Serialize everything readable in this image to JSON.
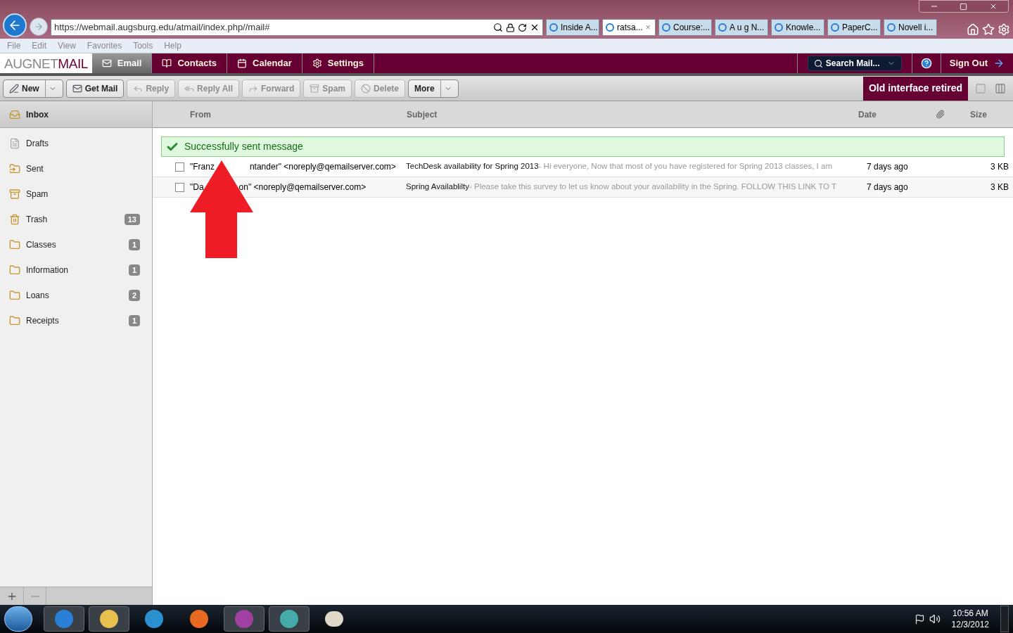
{
  "browser": {
    "address": "https://webmail.augsburg.edu/atmail/index.php//mail#",
    "tabs": [
      {
        "label": "Inside A...",
        "selected": false
      },
      {
        "label": "ratsa...",
        "selected": true,
        "close": "×"
      },
      {
        "label": "Course:...",
        "selected": false
      },
      {
        "label": "A u g N...",
        "selected": false
      },
      {
        "label": "Knowle...",
        "selected": false
      },
      {
        "label": "PaperC...",
        "selected": false
      },
      {
        "label": "Novell i...",
        "selected": false
      }
    ],
    "menu": [
      "File",
      "Edit",
      "View",
      "Favorites",
      "Tools",
      "Help"
    ]
  },
  "app": {
    "logo_light": "AUGNET",
    "logo_dark": "MAIL",
    "nav": [
      {
        "label": "Email",
        "selected": true
      },
      {
        "label": "Contacts",
        "selected": false
      },
      {
        "label": "Calendar",
        "selected": false
      },
      {
        "label": "Settings",
        "selected": false
      }
    ],
    "search": {
      "placeholder": "Search Mail..."
    },
    "sign_out": "Sign Out",
    "toolbar": [
      {
        "label": "New",
        "disabled": false,
        "dropdown": true
      },
      {
        "label": "Get Mail",
        "disabled": false,
        "dropdown": false
      },
      {
        "label": "Reply",
        "disabled": true,
        "dropdown": false
      },
      {
        "label": "Reply All",
        "disabled": true,
        "dropdown": false
      },
      {
        "label": "Forward",
        "disabled": true,
        "dropdown": false
      },
      {
        "label": "Spam",
        "disabled": true,
        "dropdown": false
      },
      {
        "label": "Delete",
        "disabled": true,
        "dropdown": false
      },
      {
        "label": "More",
        "disabled": false,
        "dropdown": true
      }
    ],
    "notice": "Old interface retired",
    "folders": [
      {
        "name": "Inbox",
        "selected": true
      },
      {
        "name": "Drafts",
        "selected": false
      },
      {
        "name": "Sent",
        "selected": false
      },
      {
        "name": "Spam",
        "selected": false
      },
      {
        "name": "Trash",
        "selected": false,
        "count": "13"
      },
      {
        "name": "Classes",
        "selected": false,
        "count": "1"
      },
      {
        "name": "Information",
        "selected": false,
        "count": "1"
      },
      {
        "name": "Loans",
        "selected": false,
        "count": "2"
      },
      {
        "name": "Receipts",
        "selected": false,
        "count": "1"
      }
    ],
    "columns": {
      "from": "From",
      "subject": "Subject",
      "date": "Date",
      "size": "Size"
    },
    "success": "Successfully sent message",
    "messages": [
      {
        "checked": false,
        "from_start": "\"Franz",
        "from_end": "ntander\" <noreply@qemailserver.com>",
        "subject": "TechDesk availability for Spring 2013",
        "preview": " - Hi everyone, Now that most of you have registered for Spring 2013 classes, I am",
        "date": "7 days ago",
        "size": "3 KB"
      },
      {
        "checked": false,
        "from_start": "\"Da",
        "from_end": "on\" <noreply@qemailserver.com>",
        "subject": "Spring Availablilty",
        "preview": " - Please take this survey to let us know about your availability in the Spring. FOLLOW THIS LINK TO T",
        "date": "7 days ago",
        "size": "3 KB"
      }
    ]
  },
  "taskbar": {
    "time": "10:56 AM",
    "date": "12/3/2012"
  }
}
